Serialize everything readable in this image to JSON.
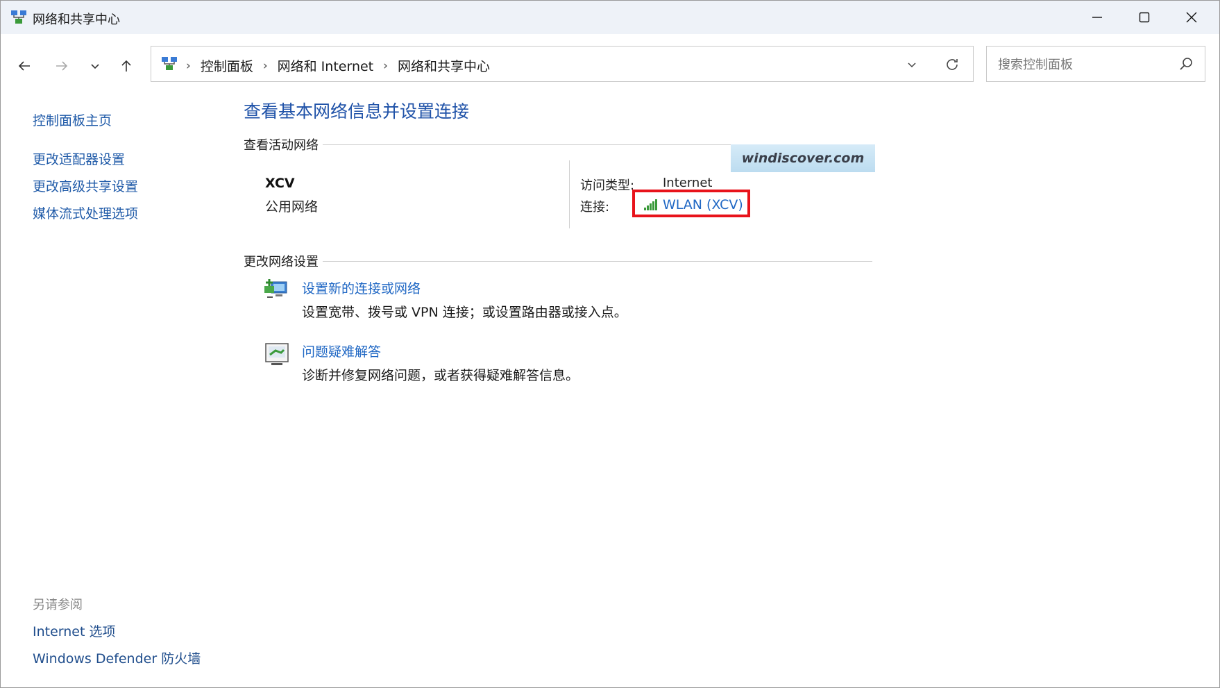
{
  "window": {
    "title": "网络和共享中心"
  },
  "address": {
    "crumbs": [
      "控制面板",
      "网络和 Internet",
      "网络和共享中心"
    ],
    "separator": "›"
  },
  "search": {
    "placeholder": "搜索控制面板"
  },
  "sidebar": {
    "items": [
      {
        "label": "控制面板主页"
      },
      {
        "label": "更改适配器设置"
      },
      {
        "label": "更改高级共享设置"
      },
      {
        "label": "媒体流式处理选项"
      }
    ],
    "see_also_label": "另请参阅",
    "see_also": [
      {
        "label": "Internet 选项"
      },
      {
        "label": "Windows Defender 防火墙"
      }
    ]
  },
  "main": {
    "heading": "查看基本网络信息并设置连接",
    "active_networks_label": "查看活动网络",
    "network": {
      "name": "XCV",
      "type": "公用网络",
      "access_type_label": "访问类型:",
      "access_type_value": "Internet",
      "connection_label": "连接:",
      "connection_value": "WLAN (XCV)"
    },
    "change_settings_label": "更改网络设置",
    "tasks": [
      {
        "title": "设置新的连接或网络",
        "description": "设置宽带、拨号或 VPN 连接；或设置路由器或接入点。",
        "icon": "new-connection-icon"
      },
      {
        "title": "问题疑难解答",
        "description": "诊断并修复网络问题，或者获得疑难解答信息。",
        "icon": "troubleshoot-icon"
      }
    ]
  },
  "watermark": "windiscover.com",
  "colors": {
    "link": "#1f67c4",
    "heading": "#1f52a8",
    "highlight_box": "#e8131b",
    "titlebar": "#eef2f8"
  }
}
